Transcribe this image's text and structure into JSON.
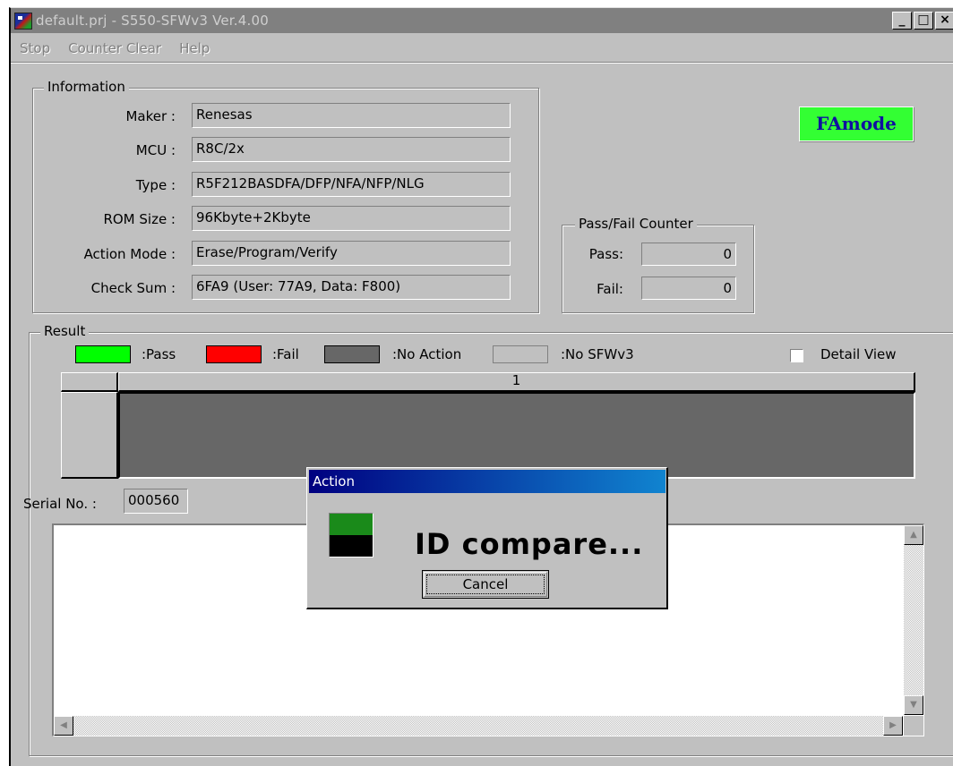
{
  "window": {
    "title": "default.prj - S550-SFWv3 Ver.4.00",
    "min_label": "_",
    "max_label": "□",
    "close_label": "×"
  },
  "menu": [
    {
      "label": "Stop"
    },
    {
      "label": "Counter Clear"
    },
    {
      "label": "Help"
    }
  ],
  "information": {
    "title": "Information",
    "fields": [
      {
        "label": "Maker :",
        "value": "Renesas"
      },
      {
        "label": "MCU :",
        "value": "R8C/2x"
      },
      {
        "label": "Type :",
        "value": "R5F212BASDFA/DFP/NFA/NFP/NLG"
      },
      {
        "label": "ROM Size :",
        "value": "96Kbyte+2Kbyte"
      },
      {
        "label": "Action Mode :",
        "value": "Erase/Program/Verify"
      },
      {
        "label": "Check Sum :",
        "value": "6FA9 (User: 77A9, Data: F800)"
      }
    ]
  },
  "mode_badge": "FAmode",
  "counter": {
    "title": "Pass/Fail Counter",
    "pass_label": "Pass:",
    "pass_value": "0",
    "fail_label": "Fail:",
    "fail_value": "0"
  },
  "result": {
    "title": "Result",
    "legend": [
      {
        "label": ":Pass",
        "color": "#00ff00"
      },
      {
        "label": ":Fail",
        "color": "#ff0000"
      },
      {
        "label": ":No Action",
        "color": "#676767"
      },
      {
        "label": ":No SFWv3",
        "color": "#c0c0c0"
      }
    ],
    "detail_view_label": "Detail View",
    "detail_view_checked": false,
    "grid_column": "1",
    "cell_color": "#676767",
    "serial_label": "Serial No. :",
    "serial_value": "000560"
  },
  "dialog": {
    "title": "Action",
    "message": "ID compare...",
    "cancel_label": "Cancel"
  }
}
